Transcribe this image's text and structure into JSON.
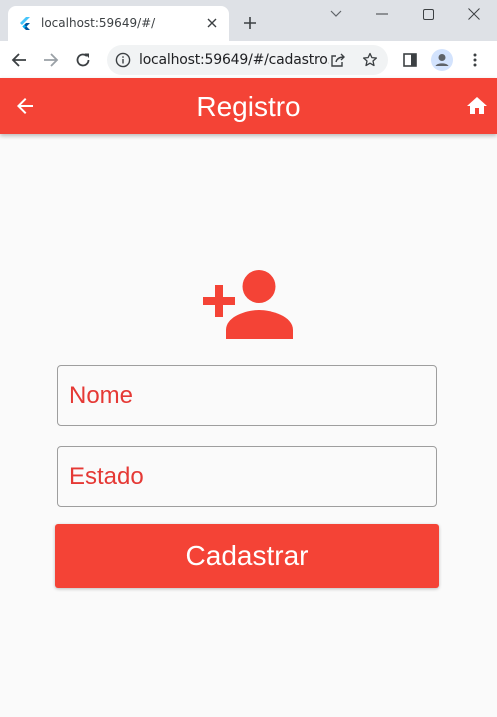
{
  "browser": {
    "tab_title": "localhost:59649/#/",
    "url": "localhost:59649/#/cadastro..."
  },
  "appbar": {
    "title": "Registro",
    "color": "#f44336"
  },
  "form": {
    "name_placeholder": "Nome",
    "state_placeholder": "Estado",
    "submit_label": "Cadastrar"
  },
  "icons": {
    "appbar_left": "arrow-back-icon",
    "appbar_right": "home-icon",
    "header": "person-add-icon"
  },
  "colors": {
    "accent": "#f44336",
    "field_text": "#e53935",
    "background": "#fafafa"
  }
}
